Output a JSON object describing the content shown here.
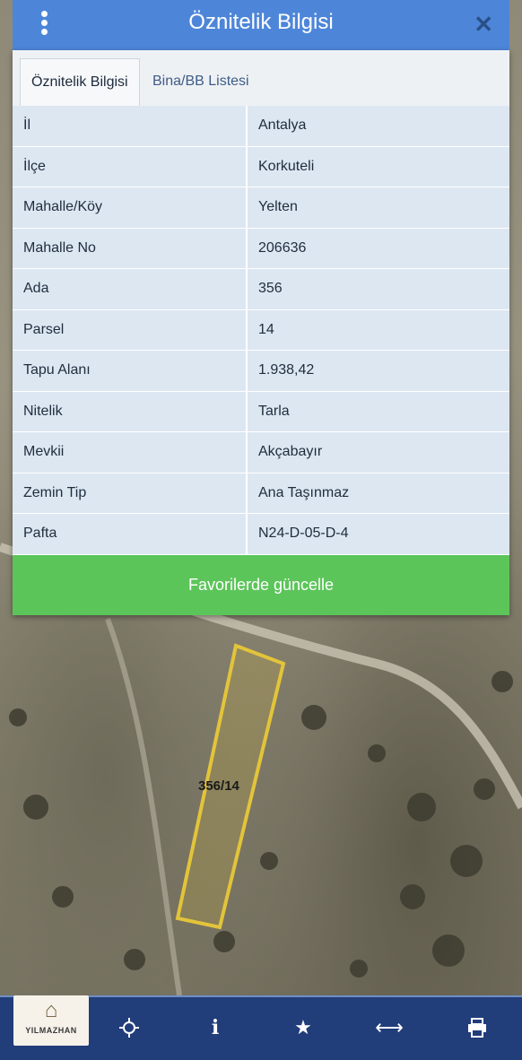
{
  "header": {
    "title": "Öznitelik Bilgisi"
  },
  "tabs": [
    {
      "label": "Öznitelik Bilgisi"
    },
    {
      "label": "Bina/BB Listesi"
    }
  ],
  "attributes": [
    {
      "key": "İl",
      "value": "Antalya"
    },
    {
      "key": "İlçe",
      "value": "Korkuteli"
    },
    {
      "key": "Mahalle/Köy",
      "value": "Yelten"
    },
    {
      "key": "Mahalle No",
      "value": "206636"
    },
    {
      "key": "Ada",
      "value": "356"
    },
    {
      "key": "Parsel",
      "value": "14"
    },
    {
      "key": "Tapu Alanı",
      "value": "1.938,42"
    },
    {
      "key": "Nitelik",
      "value": "Tarla"
    },
    {
      "key": "Mevkii",
      "value": "Akçabayır"
    },
    {
      "key": "Zemin Tip",
      "value": "Ana Taşınmaz"
    },
    {
      "key": "Pafta",
      "value": "N24-D-05-D-4"
    }
  ],
  "favorite_button": {
    "label": "Favorilerde güncelle"
  },
  "map": {
    "parcel_label": "356/14"
  },
  "logo": {
    "name": "YILMAZHAN"
  },
  "toolbar_icons": [
    "pan-icon",
    "info-icon",
    "star-icon",
    "measure-icon",
    "print-icon"
  ],
  "colors": {
    "header": "#4d86d9",
    "button": "#5cc55a",
    "toolbar": "#213d7a",
    "parcel": "#e3c43a"
  }
}
